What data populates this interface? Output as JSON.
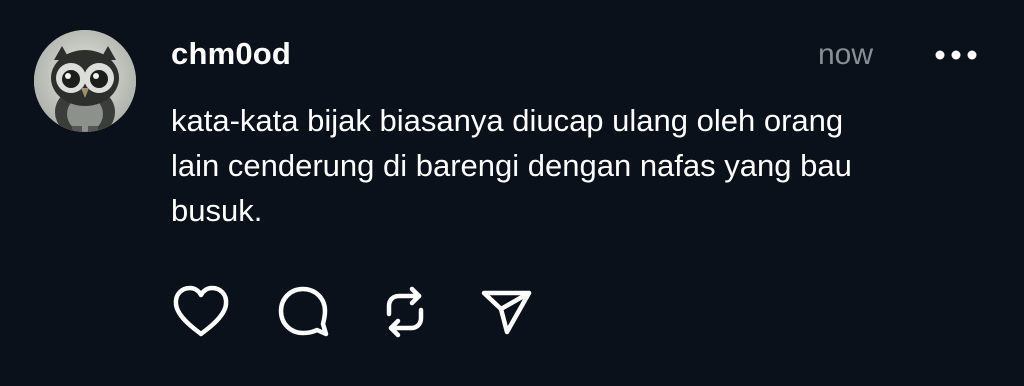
{
  "post": {
    "username": "chm0od",
    "timestamp": "now",
    "body_lines": [
      "kata-kata bijak biasanya diucap ulang oleh orang",
      "lain cenderung di barengi dengan nafas yang bau",
      "busuk."
    ]
  },
  "avatar": {
    "icon": "owl-avatar"
  },
  "actions": [
    {
      "icon": "heart-icon"
    },
    {
      "icon": "comment-icon"
    },
    {
      "icon": "repost-icon"
    },
    {
      "icon": "share-icon"
    }
  ],
  "more": {
    "icon": "more-dots-icon"
  },
  "colors": {
    "background": "#0a111a",
    "text": "#ffffff",
    "muted": "#8a8f95"
  }
}
